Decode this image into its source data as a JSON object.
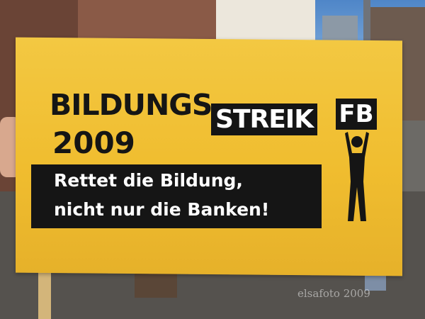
{
  "banner": {
    "title_line1": "BILDUNGS",
    "title_highlight": "STREIK",
    "year": "2009",
    "badge": "FB",
    "slogan_line1": "Rettet die Bildung,",
    "slogan_line2": "nicht nur die Banken!"
  },
  "watermark": "elsafoto 2009",
  "colors": {
    "banner_yellow": "#f0bd2f",
    "banner_ink": "#151515",
    "text_light": "#ffffff",
    "sky": "#4f86c8"
  }
}
